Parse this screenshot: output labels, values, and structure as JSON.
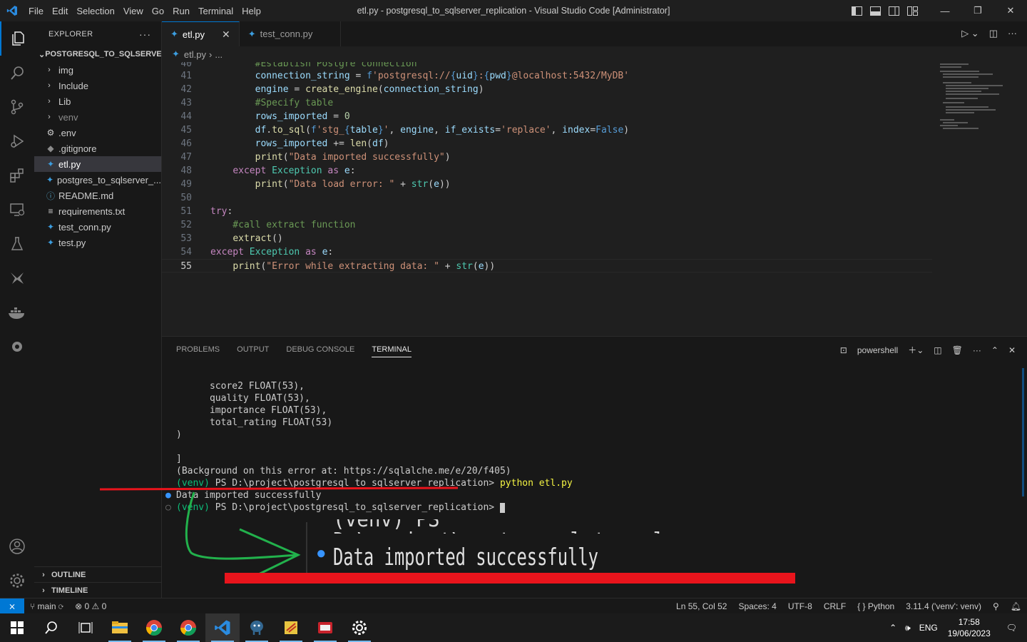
{
  "titlebar": {
    "menu": [
      "File",
      "Edit",
      "Selection",
      "View",
      "Go",
      "Run",
      "Terminal",
      "Help"
    ],
    "window_title": "etl.py - postgresql_to_sqlserver_replication - Visual Studio Code [Administrator]"
  },
  "explorer": {
    "header": "EXPLORER",
    "project": "POSTGRESQL_TO_SQLSERVE...",
    "items": [
      {
        "label": "img",
        "type": "folder"
      },
      {
        "label": "Include",
        "type": "folder"
      },
      {
        "label": "Lib",
        "type": "folder"
      },
      {
        "label": "venv",
        "type": "folder"
      },
      {
        "label": ".env",
        "type": "gear-file"
      },
      {
        "label": ".gitignore",
        "type": "git-file"
      },
      {
        "label": "etl.py",
        "type": "python"
      },
      {
        "label": "postgres_to_sqlserver_...",
        "type": "python"
      },
      {
        "label": "README.md",
        "type": "info-file"
      },
      {
        "label": "requirements.txt",
        "type": "text-file"
      },
      {
        "label": "test_conn.py",
        "type": "python"
      },
      {
        "label": "test.py",
        "type": "python"
      }
    ],
    "outline": "OUTLINE",
    "timeline": "TIMELINE"
  },
  "tabs": [
    {
      "label": "etl.py",
      "active": true
    },
    {
      "label": "test_conn.py",
      "active": false
    }
  ],
  "breadcrumb": {
    "file": "etl.py",
    "rest": "..."
  },
  "code": {
    "lines": [
      {
        "n": "40",
        "text": "        #Establish Postgre connection"
      },
      {
        "n": "41",
        "text": "        connection_string = f'postgresql://{uid}:{pwd}@localhost:5432/MyDB'"
      },
      {
        "n": "42",
        "text": "        engine = create_engine(connection_string)"
      },
      {
        "n": "43",
        "text": "        #Specify table"
      },
      {
        "n": "44",
        "text": "        rows_imported = 0"
      },
      {
        "n": "45",
        "text": "        df.to_sql(f'stg_{table}', engine, if_exists='replace', index=False)"
      },
      {
        "n": "46",
        "text": "        rows_imported += len(df)"
      },
      {
        "n": "47",
        "text": "        print(\"Data imported successfully\")"
      },
      {
        "n": "48",
        "text": "    except Exception as e:"
      },
      {
        "n": "49",
        "text": "        print(\"Data load error: \" + str(e))"
      },
      {
        "n": "50",
        "text": ""
      },
      {
        "n": "51",
        "text": "try:"
      },
      {
        "n": "52",
        "text": "    #call extract function"
      },
      {
        "n": "53",
        "text": "    extract()"
      },
      {
        "n": "54",
        "text": "except Exception as e:"
      },
      {
        "n": "55",
        "text": "    print(\"Error while extracting data: \" + str(e))"
      }
    ]
  },
  "panel": {
    "tabs": [
      "PROBLEMS",
      "OUTPUT",
      "DEBUG CONSOLE",
      "TERMINAL"
    ],
    "active_tab": "TERMINAL",
    "shell": "powershell",
    "terminal_lines": [
      "      score2 FLOAT(53),",
      "      quality FLOAT(53),",
      "      importance FLOAT(53),",
      "      total_rating FLOAT(53)",
      ")",
      "",
      "]",
      "(Background on this error at: https://sqlalche.me/e/20/f405)"
    ],
    "venv": "(venv)",
    "prompt": "PS D:\\project\\postgresql_to_sqlserver_replication>",
    "command": "python etl.py",
    "output": "Data imported successfully",
    "zoom_prompt": "(venv) PS D:\\project\\postgresql_to_sqlserver_rep",
    "zoom_output": "Data imported successfully"
  },
  "statusbar": {
    "branch": "main",
    "errors": "0",
    "warnings": "0",
    "position": "Ln 55, Col 52",
    "spaces": "Spaces: 4",
    "encoding": "UTF-8",
    "eol": "CRLF",
    "language": "Python",
    "interpreter": "3.11.4 ('venv': venv)"
  },
  "taskbar": {
    "lang": "ENG",
    "time": "17:58",
    "date": "19/06/2023"
  },
  "colors": {
    "accent": "#0078d4",
    "annotation_red": "#e8141c",
    "annotation_green": "#22b14c"
  }
}
